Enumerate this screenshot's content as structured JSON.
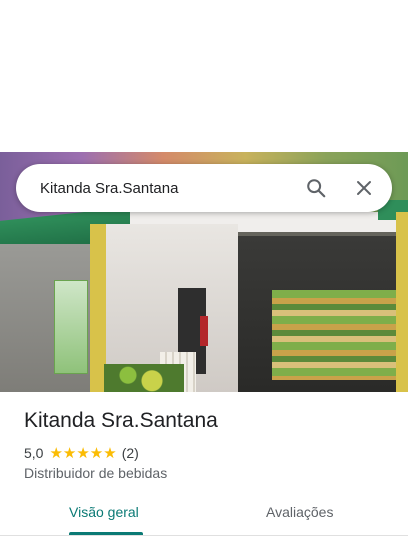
{
  "search": {
    "query": "Kitanda Sra.Santana",
    "search_icon": "search-icon",
    "clear_icon": "close-icon"
  },
  "place": {
    "name": "Kitanda Sra.Santana",
    "rating": "5,0",
    "stars": "★★★★★",
    "review_count": "(2)",
    "category": "Distribuidor de bebidas"
  },
  "tabs": [
    {
      "label": "Visão geral",
      "selected": true
    },
    {
      "label": "Avaliações",
      "selected": false
    }
  ],
  "colors": {
    "accent": "#0b7a75",
    "star": "#fbbc04"
  }
}
